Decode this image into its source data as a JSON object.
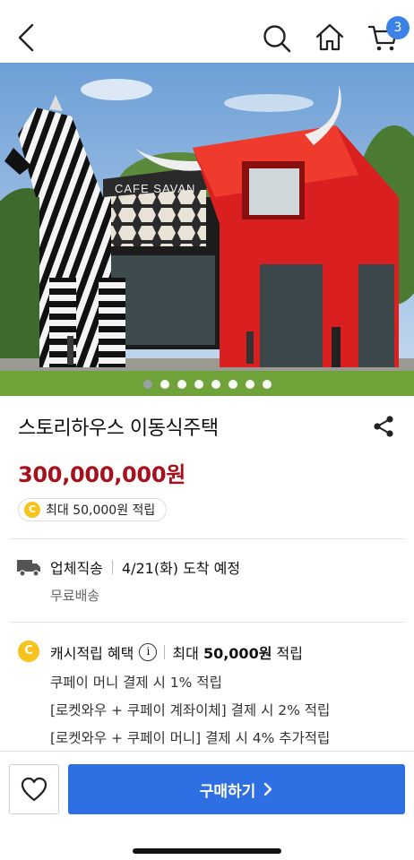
{
  "nav": {
    "back_icon": "chevron-left-icon",
    "search_icon": "search-icon",
    "home_icon": "home-icon",
    "cart_icon": "cart-icon",
    "cart_count": "3"
  },
  "gallery": {
    "total_images": 8,
    "active_index": 0,
    "sign_text": "CAFE SAVAN"
  },
  "product": {
    "title": "스토리하우스 이동식주택",
    "price": "300,000,000원",
    "cash_reward": "최대 50,000원 적립"
  },
  "shipping": {
    "method": "업체직송",
    "arrival": "4/21(화) 도착 예정",
    "fee": "무료배송"
  },
  "benefit": {
    "title": "캐시적립 혜택",
    "max": "최대",
    "amount": "50,000원",
    "suffix": "적립",
    "lines": [
      "쿠페이 머니 결제 시 1% 적립",
      "[로켓와우 + 쿠페이 계좌이체] 결제 시 2% 적립",
      "[로켓와우 + 쿠페이 머니] 결제 시 4% 추가적립"
    ]
  },
  "bottom": {
    "buy_label": "구매하기"
  },
  "colors": {
    "price": "#a5121d",
    "accent": "#2f6fe4",
    "badge": "#3b82e8",
    "coin": "#f7c31e"
  }
}
